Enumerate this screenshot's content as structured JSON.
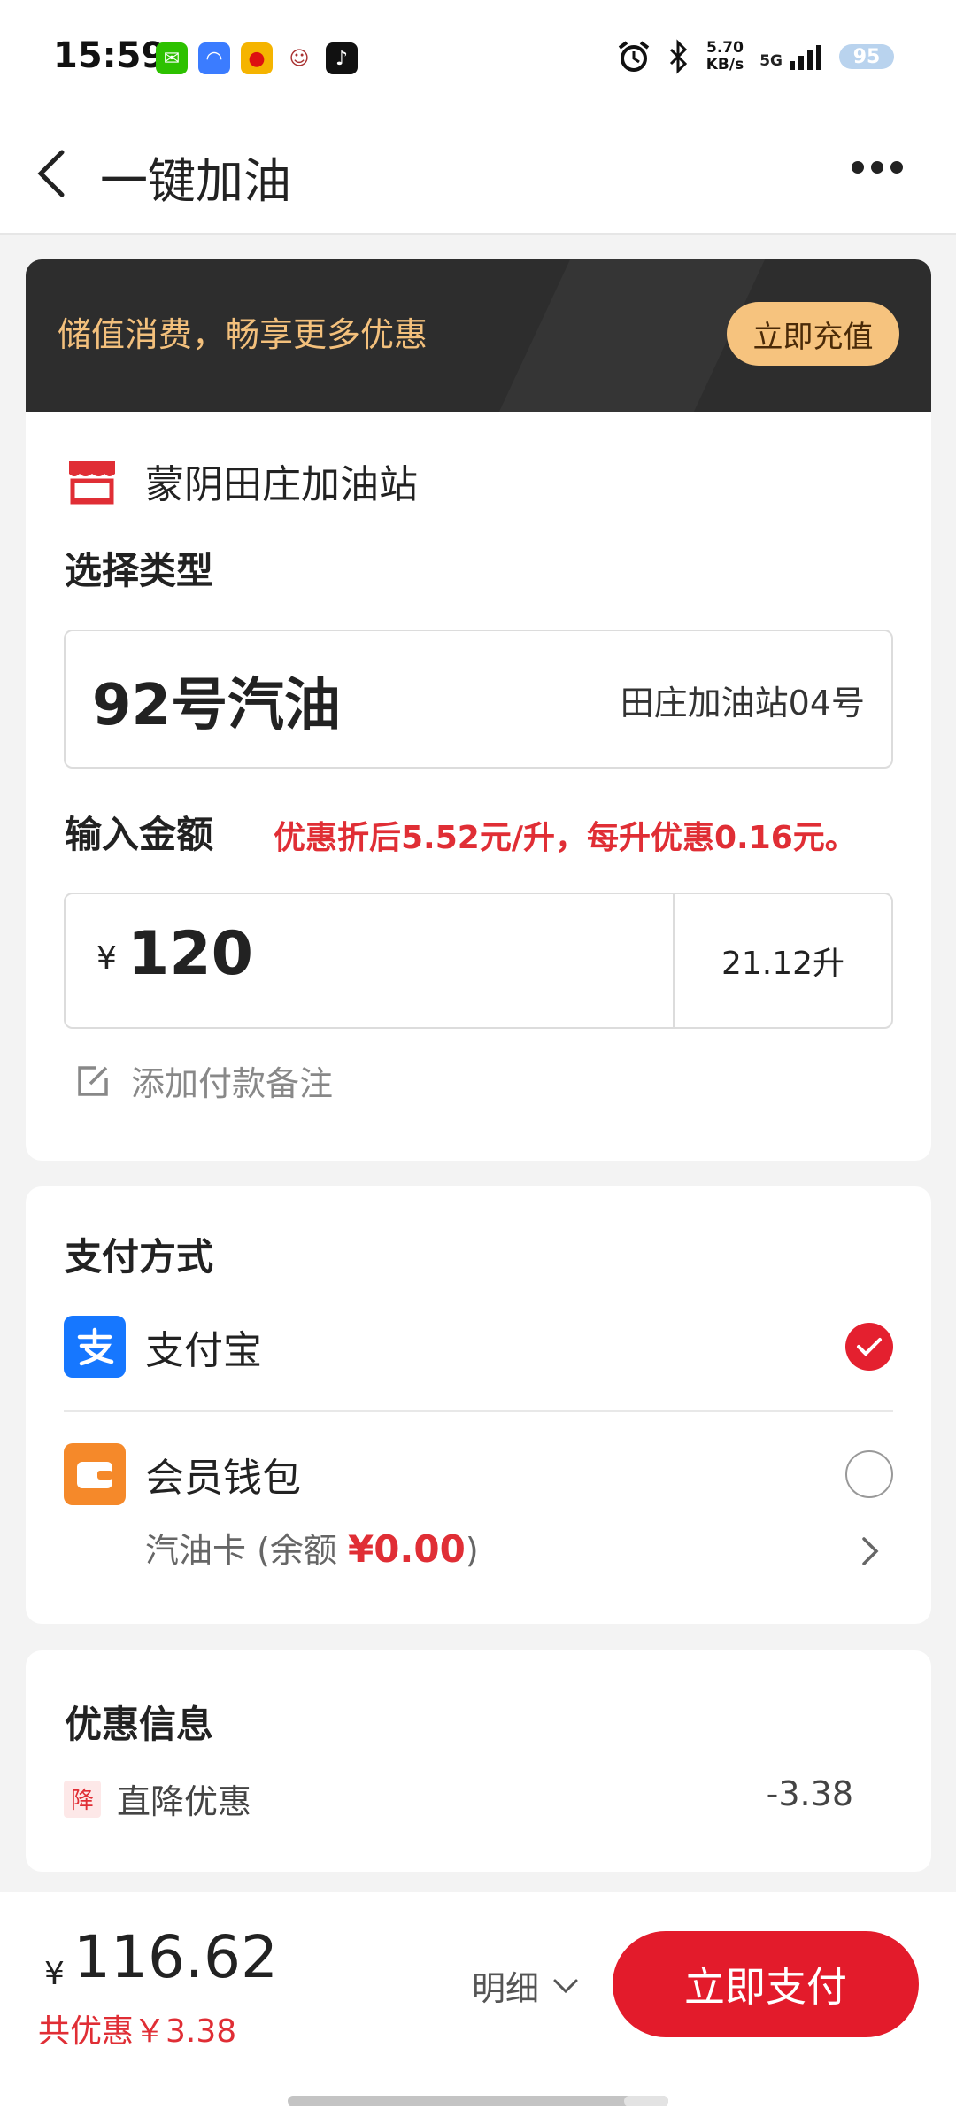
{
  "status_bar": {
    "time": "15:59",
    "net_speed_value": "5.70",
    "net_speed_unit": "KB/s",
    "network": "5G",
    "battery": "95"
  },
  "nav": {
    "title": "一键加油"
  },
  "promo_banner": {
    "text": "储值消费，畅享更多优惠",
    "button": "立即充值"
  },
  "station": {
    "name": "蒙阴田庄加油站"
  },
  "fuel": {
    "section_label": "选择类型",
    "type": "92号汽油",
    "pump": "田庄加油站04号"
  },
  "amount": {
    "section_label": "输入金额",
    "discount_note": "优惠折后5.52元/升，每升优惠0.16元。",
    "currency": "¥",
    "value": "120",
    "liters": "21.12升"
  },
  "remark": {
    "label": "添加付款备注"
  },
  "payment": {
    "section_label": "支付方式",
    "alipay": "支付宝",
    "wallet": "会员钱包",
    "card_prefix": "汽油卡 (余额 ",
    "card_balance": "¥0.00",
    "card_suffix": ")",
    "selected": "支付宝"
  },
  "promotions": {
    "section_label": "优惠信息",
    "badge": "降",
    "item_label": "直降优惠",
    "item_value": "-3.38"
  },
  "checkout": {
    "currency": "¥",
    "total": "116.62",
    "saved": "共优惠￥3.38",
    "details": "明细",
    "pay_button": "立即支付"
  },
  "colors": {
    "accent_red": "#e31b2b",
    "promo_gold": "#f6c37e",
    "alipay_blue": "#1677ff",
    "wallet_orange": "#f5892a"
  }
}
